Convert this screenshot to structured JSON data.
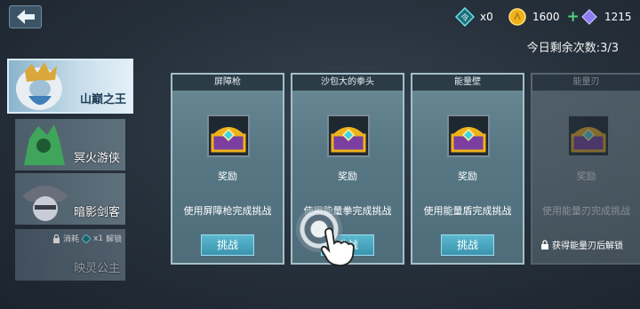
{
  "header": {
    "currencies": [
      {
        "icon": "ticket-icon",
        "value": "x0",
        "has_plus": false
      },
      {
        "icon": "gold-coin-icon",
        "value": "1600",
        "has_plus": true
      },
      {
        "icon": "diamond-icon",
        "value": "1215",
        "has_plus": true
      }
    ],
    "remaining_label": "今日剩余次数:3/3"
  },
  "heroes": [
    {
      "name": "山巅之王",
      "state": "selected"
    },
    {
      "name": "冥火游侠",
      "state": "available"
    },
    {
      "name": "暗影剑客",
      "state": "available"
    },
    {
      "name": "映灵公主",
      "state": "locked",
      "lock_text_prefix": "消耗",
      "lock_cost": "x1",
      "lock_text_suffix": "解锁"
    }
  ],
  "cards": [
    {
      "title": "屏障枪",
      "reward": "奖励",
      "desc": "使用屏障枪完成挑战",
      "button": "挑战"
    },
    {
      "title": "沙包大的拳头",
      "reward": "奖励",
      "desc": "使用能量拳完成挑战",
      "button": "挑战"
    },
    {
      "title": "能量壁",
      "reward": "奖励",
      "desc": "使用能量盾完成挑战",
      "button": "挑战"
    },
    {
      "title": "能量刃",
      "reward": "奖励",
      "desc": "使用能量刃完成挑战",
      "unlock_hint": "获得能量刃后解锁"
    }
  ],
  "colors": {
    "accent": "#4fd07d",
    "button": "#3a95ad",
    "gold": "#f0b21c",
    "gem": "#8c7cf0"
  }
}
